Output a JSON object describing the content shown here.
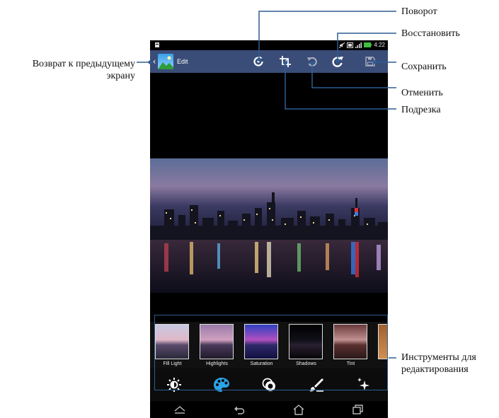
{
  "callouts": {
    "rotate": "Поворот",
    "redo": "Восстановить",
    "save": "Сохранить",
    "undo": "Отменить",
    "crop": "Подрезка",
    "back_line1": "Возврат к предыдущему",
    "back_line2": "экрану",
    "tools_line1": "Инструменты для",
    "tools_line2": "редактирования"
  },
  "status_bar": {
    "time": "4:22"
  },
  "action_bar": {
    "title": "Edit",
    "icons": [
      "back-chevron-icon",
      "gallery-app-icon",
      "rotate-icon",
      "crop-icon",
      "undo-icon",
      "redo-icon",
      "save-icon"
    ]
  },
  "tools": {
    "thumbnails": [
      {
        "label": "Fill Light"
      },
      {
        "label": "Highlights"
      },
      {
        "label": "Saturation"
      },
      {
        "label": "Shadows"
      },
      {
        "label": "Tint"
      }
    ],
    "icons": [
      "brightness-icon",
      "palette-icon",
      "filter-circles-icon",
      "brush-icon",
      "sparkle-icon"
    ],
    "accent_color": "#2aa3e8"
  },
  "nav_bar": {
    "icons": [
      "recent-apps-up-icon",
      "back-icon",
      "home-icon",
      "recents-icon"
    ]
  },
  "colors": {
    "callout_line": "#2e5d93",
    "action_bar": "#3a4d78"
  }
}
